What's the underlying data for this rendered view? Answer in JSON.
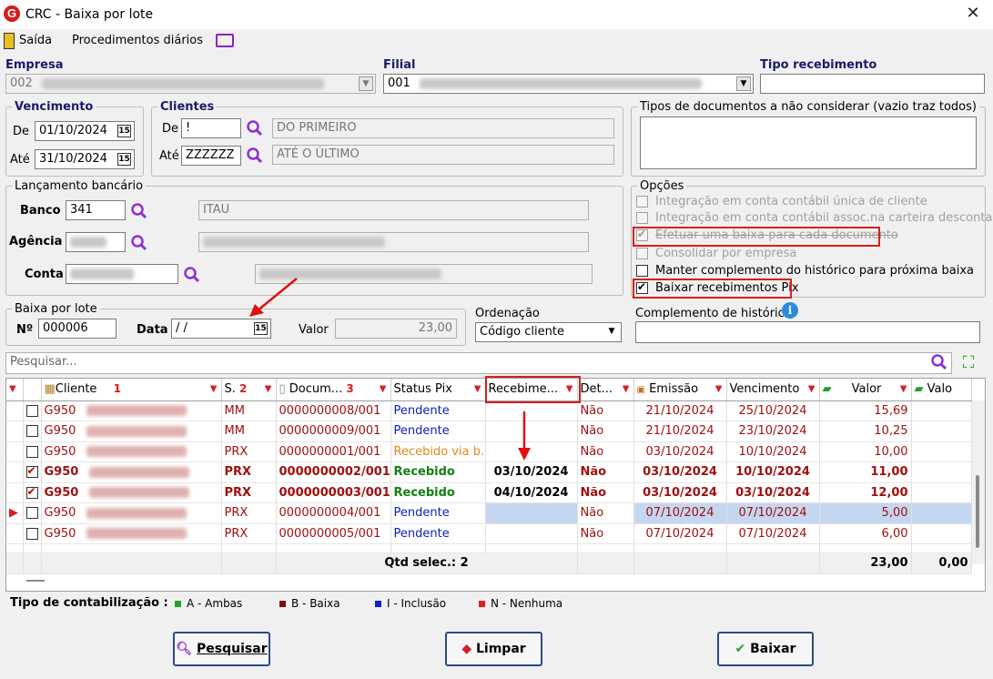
{
  "window": {
    "title": "CRC - Baixa por lote",
    "close": "✕"
  },
  "menu": {
    "exit": "Saída",
    "daily": "Procedimentos diários"
  },
  "empresa": {
    "label": "Empresa",
    "code": "002"
  },
  "filial": {
    "label": "Filial",
    "code": "001"
  },
  "tipo_recebimento": {
    "label": "Tipo recebimento",
    "value": ""
  },
  "vencimento": {
    "legend": "Vencimento",
    "de_label": "De",
    "de": "01/10/2024",
    "ate_label": "Até",
    "ate": "31/10/2024"
  },
  "clientes": {
    "legend": "Clientes",
    "de_label": "De",
    "de_code": "!",
    "de_name": "DO PRIMEIRO",
    "ate_label": "Até",
    "ate_code": "ZZZZZZ",
    "ate_name": "ATÉ O ÚLTIMO"
  },
  "tipos_doc": {
    "legend": "Tipos de documentos a não considerar (vazio traz todos)",
    "value": ""
  },
  "lancamento": {
    "legend": "Lançamento bancário",
    "banco_label": "Banco",
    "banco": "341",
    "banco_nome": "ITAU",
    "agencia_label": "Agência",
    "conta_label": "Conta"
  },
  "opcoes": {
    "legend": "Opções",
    "items": [
      {
        "label": "Integração em conta contábil única de cliente",
        "checked": false,
        "enabled": false
      },
      {
        "label": "Integração em conta contábil assoc.na carteira descontada",
        "checked": false,
        "enabled": false
      },
      {
        "label": "Efetuar uma baixa para cada documento",
        "checked": true,
        "enabled": false
      },
      {
        "label": "Consolidar por empresa",
        "checked": false,
        "enabled": false
      },
      {
        "label": "Manter complemento do histórico para próxima baixa",
        "checked": false,
        "enabled": true
      },
      {
        "label": "Baixar recebimentos Pix",
        "checked": true,
        "enabled": true
      }
    ]
  },
  "baixa_lote": {
    "legend": "Baixa por lote",
    "numero_label": "Nº",
    "numero": "000006",
    "data_label": "Data",
    "data": " / /",
    "valor_label": "Valor",
    "valor": "23,00"
  },
  "ordenacao": {
    "legend": "Ordenação",
    "value": "Código cliente"
  },
  "complemento": {
    "label": "Complemento de histórico",
    "value": ""
  },
  "search": {
    "placeholder": "Pesquisar..."
  },
  "grid": {
    "columns": {
      "cliente": "Cliente",
      "cliente_sort": "1",
      "serie": "S.",
      "serie_sort": "2",
      "documento": "Docum...",
      "documento_sort": "3",
      "status": "Status Pix",
      "recebimento": "Recebime...",
      "det": "Det...",
      "emissao": "Emissão",
      "vencimento": "Vencimento",
      "valor": "Valor",
      "valor2": "Valo"
    },
    "rows": [
      {
        "checked": false,
        "cliente": "G950",
        "serie": "MM",
        "doc": "0000000008/001",
        "status": "Pendente",
        "status_cls": "blue",
        "receb": "",
        "det": "Não",
        "emissao": "21/10/2024",
        "venc": "25/10/2024",
        "valor": "15,69",
        "bold": false,
        "current": false
      },
      {
        "checked": false,
        "cliente": "G950",
        "serie": "MM",
        "doc": "0000000009/001",
        "status": "Pendente",
        "status_cls": "blue",
        "receb": "",
        "det": "Não",
        "emissao": "21/10/2024",
        "venc": "23/10/2024",
        "valor": "10,25",
        "bold": false,
        "current": false
      },
      {
        "checked": false,
        "cliente": "G950",
        "serie": "PRX",
        "doc": "0000000001/001",
        "status": "Recebido via b...",
        "status_cls": "orange",
        "receb": "",
        "det": "Não",
        "emissao": "03/10/2024",
        "venc": "10/10/2024",
        "valor": "10,00",
        "bold": false,
        "current": false
      },
      {
        "checked": true,
        "cliente": "G950",
        "serie": "PRX",
        "doc": "0000000002/001",
        "status": "Recebido",
        "status_cls": "green",
        "receb": "03/10/2024",
        "det": "Não",
        "emissao": "03/10/2024",
        "venc": "10/10/2024",
        "valor": "11,00",
        "bold": true,
        "current": false
      },
      {
        "checked": true,
        "cliente": "G950",
        "serie": "PRX",
        "doc": "0000000003/001",
        "status": "Recebido",
        "status_cls": "green",
        "receb": "04/10/2024",
        "det": "Não",
        "emissao": "03/10/2024",
        "venc": "03/10/2024",
        "valor": "12,00",
        "bold": true,
        "current": false
      },
      {
        "checked": false,
        "cliente": "G950",
        "serie": "PRX",
        "doc": "0000000004/001",
        "status": "Pendente",
        "status_cls": "blue",
        "receb": "",
        "det": "Não",
        "emissao": "07/10/2024",
        "venc": "07/10/2024",
        "valor": "5,00",
        "bold": false,
        "current": true
      },
      {
        "checked": false,
        "cliente": "G950",
        "serie": "PRX",
        "doc": "0000000005/001",
        "status": "Pendente",
        "status_cls": "blue",
        "receb": "",
        "det": "Não",
        "emissao": "07/10/2024",
        "venc": "07/10/2024",
        "valor": "6,00",
        "bold": false,
        "current": false
      }
    ],
    "totals": {
      "qtd": "Qtd selec.: 2",
      "valor": "23,00",
      "valor2": "0,00"
    }
  },
  "contabilizacao": {
    "label": "Tipo de contabilização :",
    "items": [
      {
        "color": "#2aa02a",
        "label": "A - Ambas"
      },
      {
        "color": "#801010",
        "label": "B - Baixa"
      },
      {
        "color": "#1020d0",
        "label": "I - Inclusão"
      },
      {
        "color": "#e02020",
        "label": "N - Nenhuma"
      }
    ]
  },
  "buttons": {
    "pesquisar": "Pesquisar",
    "limpar": "Limpar",
    "baixar": "Baixar"
  }
}
